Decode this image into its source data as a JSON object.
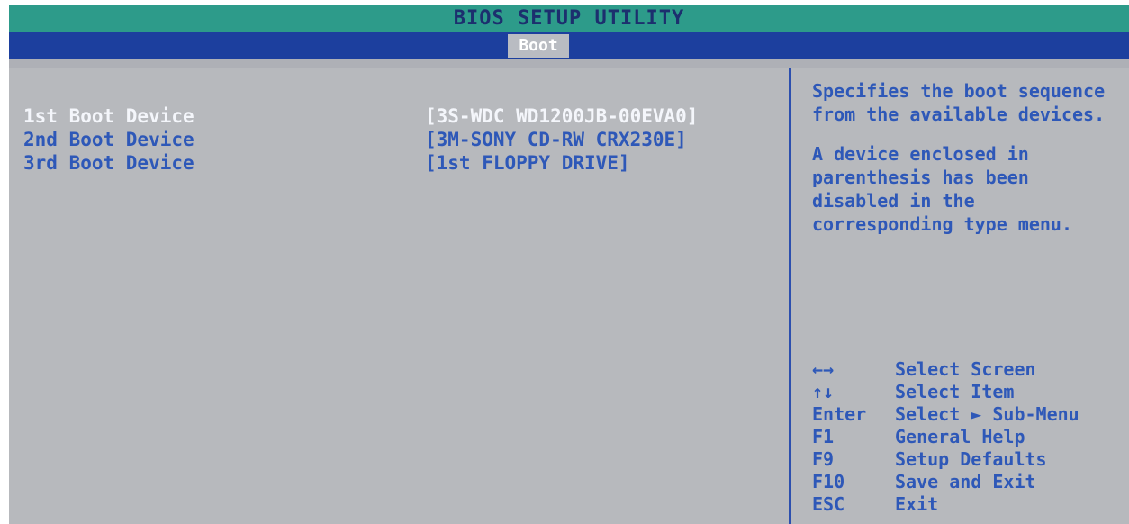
{
  "title": "BIOS SETUP UTILITY",
  "tabs": [
    {
      "label": "Boot",
      "active": true
    }
  ],
  "boot_devices": [
    {
      "label": "1st Boot Device",
      "value": "[3S-WDC WD1200JB-00EVA0]",
      "selected": true
    },
    {
      "label": "2nd Boot Device",
      "value": "[3M-SONY CD-RW CRX230E]",
      "selected": false
    },
    {
      "label": "3rd Boot Device",
      "value": "[1st FLOPPY DRIVE]",
      "selected": false
    }
  ],
  "help": {
    "paragraph1": "Specifies the boot sequence from the available devices.",
    "paragraph2": "A device enclosed in parenthesis has been disabled in the corresponding type menu."
  },
  "key_legend": [
    {
      "key": "←→",
      "action": "Select Screen"
    },
    {
      "key": "↑↓",
      "action": "Select Item"
    },
    {
      "key": "Enter",
      "action": "Select ► Sub-Menu"
    },
    {
      "key": "F1",
      "action": "General Help"
    },
    {
      "key": "F9",
      "action": "Setup Defaults"
    },
    {
      "key": "F10",
      "action": "Save and Exit"
    },
    {
      "key": "ESC",
      "action": "Exit"
    }
  ],
  "colors": {
    "title_bar": "#2d9b8a",
    "menu_bar": "#1c3f9e",
    "panel_background": "#b7b9bd",
    "item_text": "#2e58b8",
    "selected_text": "#f4f6fb",
    "title_text": "#1c2f6e"
  }
}
